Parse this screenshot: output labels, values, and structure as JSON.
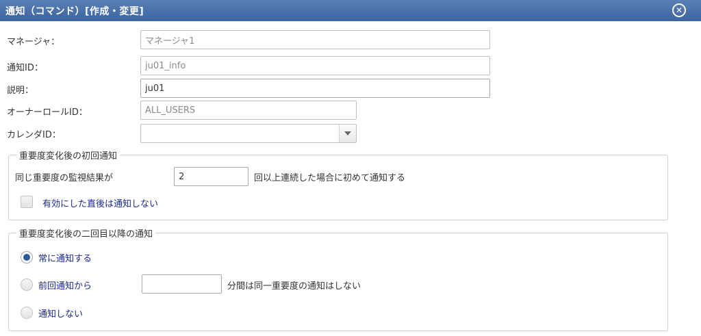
{
  "window": {
    "title": "通知（コマンド）[作成・変更]"
  },
  "form": {
    "manager": {
      "label": "マネージャ：",
      "value": "マネージャ1"
    },
    "notify_id": {
      "label": "通知ID：",
      "value": "ju01_info"
    },
    "description": {
      "label": "説明：",
      "value": "ju01"
    },
    "owner_role_id": {
      "label": "オーナーロールID：",
      "value": "ALL_USERS"
    },
    "calendar_id": {
      "label": "カレンダID：",
      "value": ""
    }
  },
  "initial_notify": {
    "legend": "重要度変化後の初回通知",
    "same_result_label": "同じ重要度の監視結果が",
    "count_value": "2",
    "count_suffix": "回以上連続した場合に初めて通知する",
    "checkbox_label": "有効にした直後は通知しない",
    "checkbox_checked": false
  },
  "subsequent_notify": {
    "legend": "重要度変化後の二回目以降の通知",
    "options": [
      {
        "label": "常に通知する",
        "selected": true
      },
      {
        "label": "前回通知から",
        "selected": false
      },
      {
        "label": "通知しない",
        "selected": false
      }
    ],
    "minutes_value": "",
    "minutes_suffix": "分間は同一重要度の通知はしない"
  },
  "icons": {
    "close": "close-circle-icon",
    "dropdown": "chevron-down-icon"
  },
  "colors": {
    "titlebar": "#3c64a0",
    "radio_selected": "#2e5b95",
    "option_text": "#1a2a8a"
  }
}
